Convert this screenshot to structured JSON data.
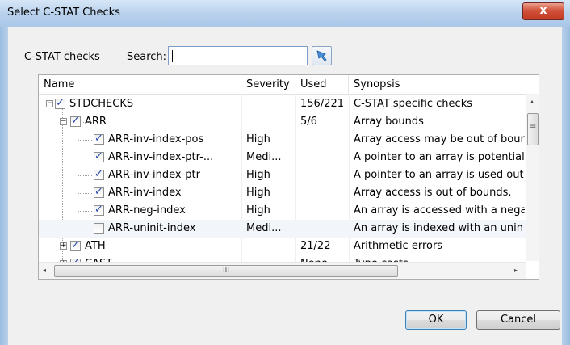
{
  "window": {
    "title": "Select C-STAT Checks",
    "close_glyph": "x"
  },
  "toolbar": {
    "cstat_label": "C-STAT checks",
    "search_label": "Search:",
    "search_value": "",
    "filter_icon": "filter-icon"
  },
  "columns": [
    "Name",
    "Severity",
    "Used",
    "Synopsis"
  ],
  "rows": [
    {
      "name": "STDCHECKS",
      "severity": "",
      "used": "156/221",
      "synopsis": "C-STAT specific checks",
      "checked": true,
      "expander": "minus",
      "level": 0
    },
    {
      "name": "ARR",
      "severity": "",
      "used": "5/6",
      "synopsis": "Array bounds",
      "checked": true,
      "expander": "minus",
      "level": 1
    },
    {
      "name": "ARR-inv-index-pos",
      "severity": "High",
      "used": "",
      "synopsis": "Array access may be out of bour",
      "checked": true,
      "expander": "",
      "level": 2
    },
    {
      "name": "ARR-inv-index-ptr-...",
      "severity": "Medi...",
      "used": "",
      "synopsis": "A pointer to an array is potential",
      "checked": true,
      "expander": "",
      "level": 2
    },
    {
      "name": "ARR-inv-index-ptr",
      "severity": "High",
      "used": "",
      "synopsis": "A pointer to an array is used out",
      "checked": true,
      "expander": "",
      "level": 2
    },
    {
      "name": "ARR-inv-index",
      "severity": "High",
      "used": "",
      "synopsis": "Array access is out of bounds.",
      "checked": true,
      "expander": "",
      "level": 2
    },
    {
      "name": "ARR-neg-index",
      "severity": "High",
      "used": "",
      "synopsis": "An array is accessed with a nega",
      "checked": true,
      "expander": "",
      "level": 2
    },
    {
      "name": "ARR-uninit-index",
      "severity": "Medi...",
      "used": "",
      "synopsis": "An array is indexed with an unin",
      "checked": false,
      "expander": "",
      "level": 2
    },
    {
      "name": "ATH",
      "severity": "",
      "used": "21/22",
      "synopsis": "Arithmetic errors",
      "checked": true,
      "expander": "plus",
      "level": 1
    },
    {
      "name": "CAST",
      "severity": "",
      "used": "None",
      "synopsis": "Type casts",
      "checked": true,
      "expander": "plus",
      "level": 1
    }
  ],
  "scrollbar": {
    "thumb_grip": "III",
    "left_arrow": "◂",
    "right_arrow": "▸",
    "up_arrow": "▴"
  },
  "buttons": {
    "ok": "OK",
    "cancel": "Cancel"
  }
}
